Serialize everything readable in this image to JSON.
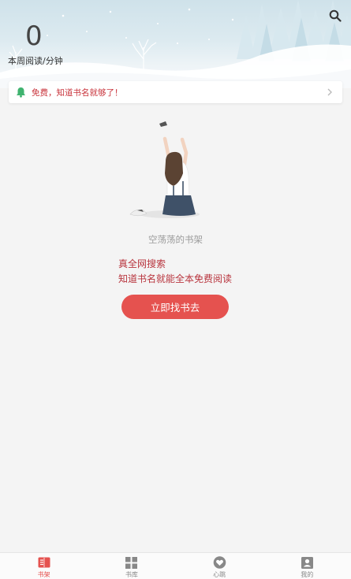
{
  "header": {
    "minutes_value": "0",
    "minutes_label": "本周阅读/分钟",
    "search_icon": "search-icon"
  },
  "notice": {
    "icon": "bell-icon",
    "text": "免费，知道书名就够了！",
    "chevron_icon": "chevron-right-icon"
  },
  "empty": {
    "label": "空荡荡的书架",
    "promo_line1": "真全网搜索",
    "promo_line2": "知道书名就能全本免费阅读",
    "cta_label": "立即找书去"
  },
  "tabbar": {
    "items": [
      {
        "label": "书架",
        "icon": "bookshelf-icon",
        "active": true
      },
      {
        "label": "书库",
        "icon": "grid-icon",
        "active": false
      },
      {
        "label": "心跳",
        "icon": "heart-icon",
        "active": false
      },
      {
        "label": "我的",
        "icon": "profile-icon",
        "active": false
      }
    ]
  },
  "colors": {
    "accent": "#e5524f",
    "notice_text": "#c8333b",
    "bell_green": "#3fb36f",
    "background": "#f4f4f4"
  }
}
